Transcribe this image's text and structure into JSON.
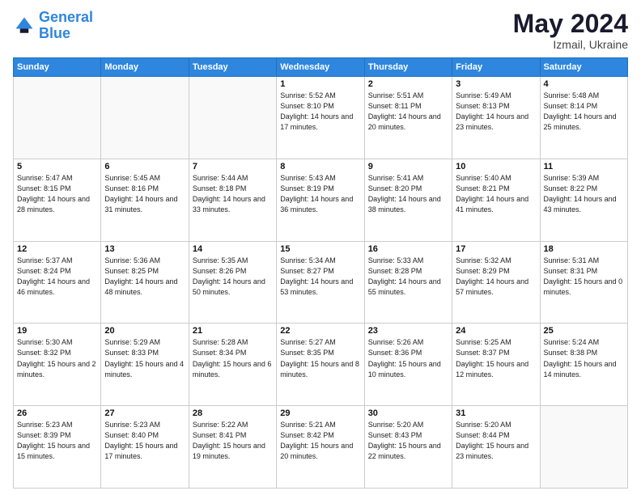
{
  "logo": {
    "text_general": "General",
    "text_blue": "Blue"
  },
  "title": {
    "main": "May 2024",
    "sub": "Izmail, Ukraine"
  },
  "headers": [
    "Sunday",
    "Monday",
    "Tuesday",
    "Wednesday",
    "Thursday",
    "Friday",
    "Saturday"
  ],
  "weeks": [
    [
      {
        "day": "",
        "sunrise": "",
        "sunset": "",
        "daylight": ""
      },
      {
        "day": "",
        "sunrise": "",
        "sunset": "",
        "daylight": ""
      },
      {
        "day": "",
        "sunrise": "",
        "sunset": "",
        "daylight": ""
      },
      {
        "day": "1",
        "sunrise": "Sunrise: 5:52 AM",
        "sunset": "Sunset: 8:10 PM",
        "daylight": "Daylight: 14 hours and 17 minutes."
      },
      {
        "day": "2",
        "sunrise": "Sunrise: 5:51 AM",
        "sunset": "Sunset: 8:11 PM",
        "daylight": "Daylight: 14 hours and 20 minutes."
      },
      {
        "day": "3",
        "sunrise": "Sunrise: 5:49 AM",
        "sunset": "Sunset: 8:13 PM",
        "daylight": "Daylight: 14 hours and 23 minutes."
      },
      {
        "day": "4",
        "sunrise": "Sunrise: 5:48 AM",
        "sunset": "Sunset: 8:14 PM",
        "daylight": "Daylight: 14 hours and 25 minutes."
      }
    ],
    [
      {
        "day": "5",
        "sunrise": "Sunrise: 5:47 AM",
        "sunset": "Sunset: 8:15 PM",
        "daylight": "Daylight: 14 hours and 28 minutes."
      },
      {
        "day": "6",
        "sunrise": "Sunrise: 5:45 AM",
        "sunset": "Sunset: 8:16 PM",
        "daylight": "Daylight: 14 hours and 31 minutes."
      },
      {
        "day": "7",
        "sunrise": "Sunrise: 5:44 AM",
        "sunset": "Sunset: 8:18 PM",
        "daylight": "Daylight: 14 hours and 33 minutes."
      },
      {
        "day": "8",
        "sunrise": "Sunrise: 5:43 AM",
        "sunset": "Sunset: 8:19 PM",
        "daylight": "Daylight: 14 hours and 36 minutes."
      },
      {
        "day": "9",
        "sunrise": "Sunrise: 5:41 AM",
        "sunset": "Sunset: 8:20 PM",
        "daylight": "Daylight: 14 hours and 38 minutes."
      },
      {
        "day": "10",
        "sunrise": "Sunrise: 5:40 AM",
        "sunset": "Sunset: 8:21 PM",
        "daylight": "Daylight: 14 hours and 41 minutes."
      },
      {
        "day": "11",
        "sunrise": "Sunrise: 5:39 AM",
        "sunset": "Sunset: 8:22 PM",
        "daylight": "Daylight: 14 hours and 43 minutes."
      }
    ],
    [
      {
        "day": "12",
        "sunrise": "Sunrise: 5:37 AM",
        "sunset": "Sunset: 8:24 PM",
        "daylight": "Daylight: 14 hours and 46 minutes."
      },
      {
        "day": "13",
        "sunrise": "Sunrise: 5:36 AM",
        "sunset": "Sunset: 8:25 PM",
        "daylight": "Daylight: 14 hours and 48 minutes."
      },
      {
        "day": "14",
        "sunrise": "Sunrise: 5:35 AM",
        "sunset": "Sunset: 8:26 PM",
        "daylight": "Daylight: 14 hours and 50 minutes."
      },
      {
        "day": "15",
        "sunrise": "Sunrise: 5:34 AM",
        "sunset": "Sunset: 8:27 PM",
        "daylight": "Daylight: 14 hours and 53 minutes."
      },
      {
        "day": "16",
        "sunrise": "Sunrise: 5:33 AM",
        "sunset": "Sunset: 8:28 PM",
        "daylight": "Daylight: 14 hours and 55 minutes."
      },
      {
        "day": "17",
        "sunrise": "Sunrise: 5:32 AM",
        "sunset": "Sunset: 8:29 PM",
        "daylight": "Daylight: 14 hours and 57 minutes."
      },
      {
        "day": "18",
        "sunrise": "Sunrise: 5:31 AM",
        "sunset": "Sunset: 8:31 PM",
        "daylight": "Daylight: 15 hours and 0 minutes."
      }
    ],
    [
      {
        "day": "19",
        "sunrise": "Sunrise: 5:30 AM",
        "sunset": "Sunset: 8:32 PM",
        "daylight": "Daylight: 15 hours and 2 minutes."
      },
      {
        "day": "20",
        "sunrise": "Sunrise: 5:29 AM",
        "sunset": "Sunset: 8:33 PM",
        "daylight": "Daylight: 15 hours and 4 minutes."
      },
      {
        "day": "21",
        "sunrise": "Sunrise: 5:28 AM",
        "sunset": "Sunset: 8:34 PM",
        "daylight": "Daylight: 15 hours and 6 minutes."
      },
      {
        "day": "22",
        "sunrise": "Sunrise: 5:27 AM",
        "sunset": "Sunset: 8:35 PM",
        "daylight": "Daylight: 15 hours and 8 minutes."
      },
      {
        "day": "23",
        "sunrise": "Sunrise: 5:26 AM",
        "sunset": "Sunset: 8:36 PM",
        "daylight": "Daylight: 15 hours and 10 minutes."
      },
      {
        "day": "24",
        "sunrise": "Sunrise: 5:25 AM",
        "sunset": "Sunset: 8:37 PM",
        "daylight": "Daylight: 15 hours and 12 minutes."
      },
      {
        "day": "25",
        "sunrise": "Sunrise: 5:24 AM",
        "sunset": "Sunset: 8:38 PM",
        "daylight": "Daylight: 15 hours and 14 minutes."
      }
    ],
    [
      {
        "day": "26",
        "sunrise": "Sunrise: 5:23 AM",
        "sunset": "Sunset: 8:39 PM",
        "daylight": "Daylight: 15 hours and 15 minutes."
      },
      {
        "day": "27",
        "sunrise": "Sunrise: 5:23 AM",
        "sunset": "Sunset: 8:40 PM",
        "daylight": "Daylight: 15 hours and 17 minutes."
      },
      {
        "day": "28",
        "sunrise": "Sunrise: 5:22 AM",
        "sunset": "Sunset: 8:41 PM",
        "daylight": "Daylight: 15 hours and 19 minutes."
      },
      {
        "day": "29",
        "sunrise": "Sunrise: 5:21 AM",
        "sunset": "Sunset: 8:42 PM",
        "daylight": "Daylight: 15 hours and 20 minutes."
      },
      {
        "day": "30",
        "sunrise": "Sunrise: 5:20 AM",
        "sunset": "Sunset: 8:43 PM",
        "daylight": "Daylight: 15 hours and 22 minutes."
      },
      {
        "day": "31",
        "sunrise": "Sunrise: 5:20 AM",
        "sunset": "Sunset: 8:44 PM",
        "daylight": "Daylight: 15 hours and 23 minutes."
      },
      {
        "day": "",
        "sunrise": "",
        "sunset": "",
        "daylight": ""
      }
    ]
  ]
}
